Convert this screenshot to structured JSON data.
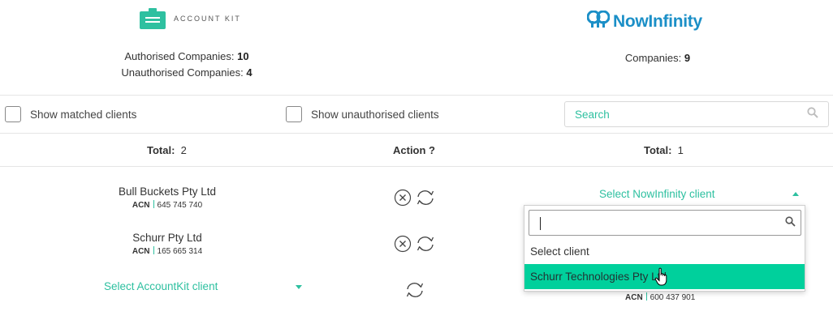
{
  "accountkit": {
    "brand": "ACCOUNT KIT",
    "authorised_label": "Authorised Companies:",
    "authorised_count": "10",
    "unauthorised_label": "Unauthorised Companies:",
    "unauthorised_count": "4"
  },
  "nowinfinity": {
    "brand": "NowInfinity",
    "companies_label": "Companies:",
    "companies_count": "9"
  },
  "filters": {
    "show_matched": "Show matched clients",
    "show_unauthorised": "Show unauthorised clients",
    "search_placeholder": "Search"
  },
  "columns": {
    "left_total_label": "Total:",
    "left_total_value": "2",
    "action_label": "Action ?",
    "right_total_label": "Total:",
    "right_total_value": "1"
  },
  "rows": [
    {
      "name": "Bull Buckets Pty Ltd",
      "acn_label": "ACN",
      "acn": "645 745 740"
    },
    {
      "name": "Schurr Pty Ltd",
      "acn_label": "ACN",
      "acn": "165 665 314"
    }
  ],
  "select_accountkit_client": "Select AccountKit client",
  "select_nowinfinity_client": "Select NowInfinity client",
  "dropdown": {
    "options": [
      "Select client",
      "Schurr Technologies Pty Ltd"
    ],
    "highlighted_index": 1
  },
  "hidden_row": {
    "acn_label": "ACN",
    "acn": "600 437 901"
  },
  "colors": {
    "accent": "#2ec0a0",
    "highlight": "#00d09c",
    "nowinfinity_blue": "#1b8fc7"
  },
  "icons": [
    "briefcase-icon",
    "nowinfinity-logo-icon",
    "search-icon",
    "cancel-circle-icon",
    "sync-icon",
    "hand-cursor-icon"
  ]
}
